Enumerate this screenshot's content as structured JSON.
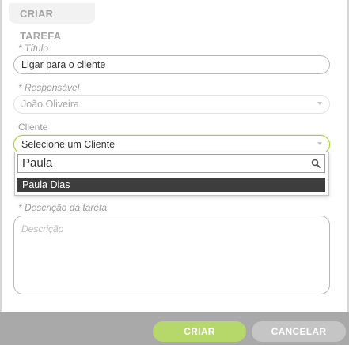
{
  "dialog": {
    "title": "CRIAR TAREFA"
  },
  "form": {
    "titulo_label": "* Título",
    "titulo_value": "Ligar para o cliente",
    "responsavel_label": "* Responsável",
    "responsavel_value": "João Oliveira",
    "cliente_label": "Cliente",
    "cliente_placeholder": "Selecione um Cliente",
    "cliente_search_value": "Paula",
    "cliente_results": [
      "Paula Dias"
    ],
    "descricao_label": "* Descrição da tarefa",
    "descricao_placeholder": "Descrição"
  },
  "buttons": {
    "create": "CRIAR",
    "cancel": "CANCELAR"
  },
  "colors": {
    "accent": "#b6d76a",
    "focus_border": "#a7cc3f",
    "highlight": "#3d3d3d",
    "footer": "#a9a9a9"
  },
  "icons": {
    "search": "search-icon",
    "dropdown": "chevron-down-icon"
  }
}
